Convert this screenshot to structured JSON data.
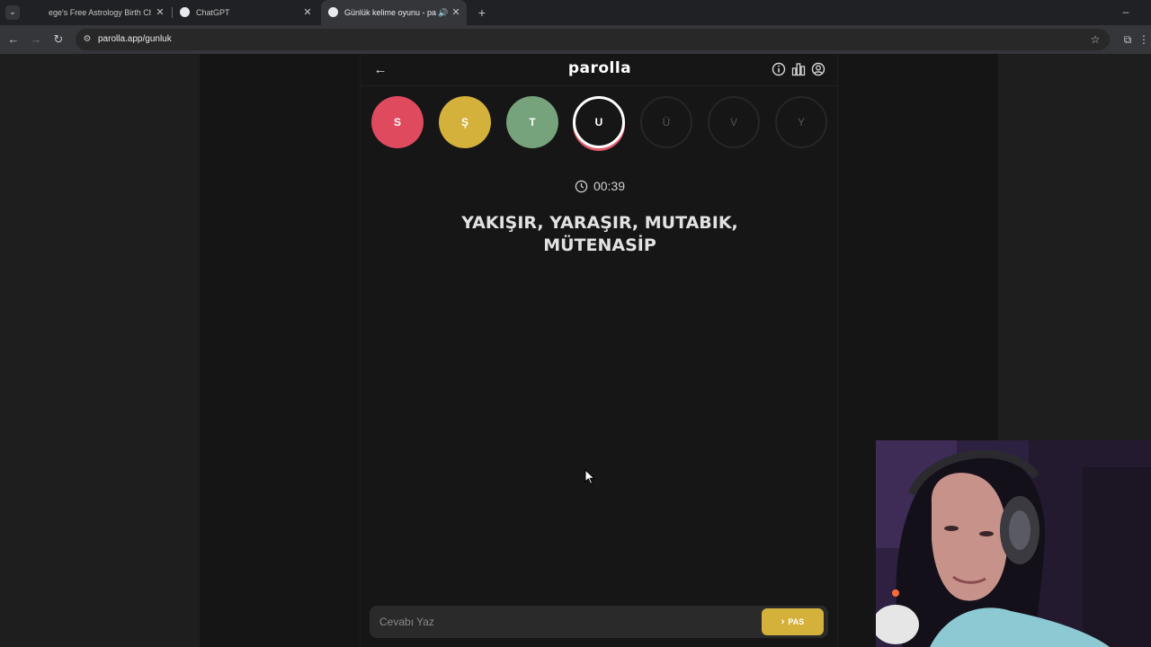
{
  "browser": {
    "tabs": [
      {
        "title": "ege's Free Astrology Birth Chart",
        "active": false
      },
      {
        "title": "ChatGPT",
        "active": false
      },
      {
        "title": "Günlük kelime oyunu - parolla",
        "active": true
      }
    ],
    "url": "parolla.app/gunluk"
  },
  "app": {
    "logo": "parolla",
    "letters": [
      {
        "letter": "S",
        "state": "wrong"
      },
      {
        "letter": "Ş",
        "state": "passed"
      },
      {
        "letter": "T",
        "state": "correct"
      },
      {
        "letter": "U",
        "state": "current"
      },
      {
        "letter": "Ü",
        "state": "pending"
      },
      {
        "letter": "V",
        "state": "pending"
      },
      {
        "letter": "Y",
        "state": "pending"
      }
    ],
    "timer": "00:39",
    "clue_line1": "YAKIŞIR, YARAŞIR, MUTABIK,",
    "clue_line2": "MÜTENASİP",
    "answer_placeholder": "Cevabı Yaz",
    "pass_label": "PAS"
  },
  "colors": {
    "wrong": "#df4a5e",
    "passed": "#d4b13a",
    "correct": "#76a27c",
    "background": "#161616"
  }
}
